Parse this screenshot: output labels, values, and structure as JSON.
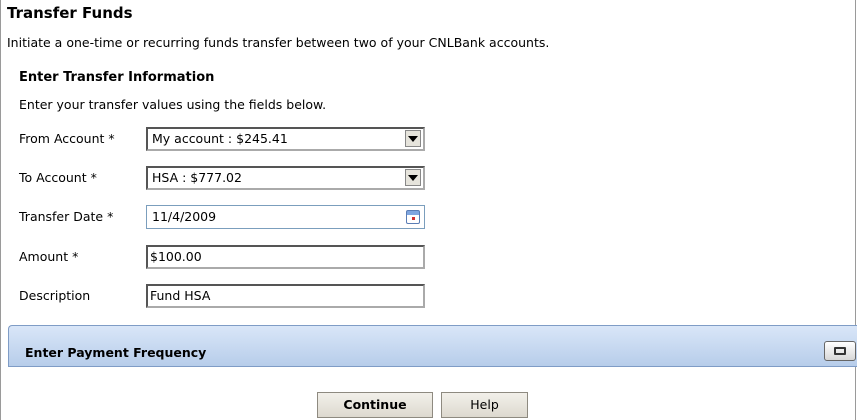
{
  "page": {
    "title": "Transfer Funds",
    "subtitle": "Initiate a one-time or recurring funds transfer between two of your CNLBank accounts."
  },
  "transfer": {
    "heading": "Enter Transfer Information",
    "description": "Enter your transfer values using the fields below.",
    "from_account": {
      "label": "From Account *",
      "value": "My account : $245.41"
    },
    "to_account": {
      "label": "To Account *",
      "value": "HSA : $777.02"
    },
    "transfer_date": {
      "label": "Transfer Date *",
      "value": "11/4/2009",
      "icon": "calendar-icon"
    },
    "amount": {
      "label": "Amount *",
      "value": "$100.00"
    },
    "description_field": {
      "label": "Description",
      "value": "Fund HSA"
    }
  },
  "payment_frequency": {
    "heading": "Enter Payment Frequency",
    "toggle_icon": "expand-icon"
  },
  "buttons": {
    "continue": "Continue",
    "help": "Help"
  },
  "colors": {
    "panel_gradient_top": "#d9e6f8",
    "panel_gradient_bottom": "#b7cdea",
    "panel_border": "#7f9cc6"
  }
}
